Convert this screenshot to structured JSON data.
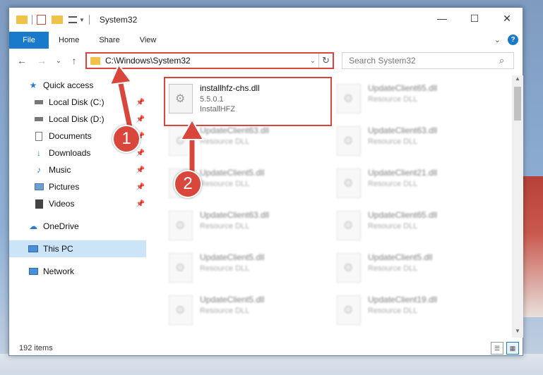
{
  "window": {
    "title": "System32",
    "controls": {
      "minimize": "—",
      "maximize": "☐",
      "close": "✕"
    }
  },
  "ribbon": {
    "tabs": [
      "File",
      "Home",
      "Share",
      "View"
    ],
    "expand_icon": "chevron-down-icon",
    "help": "?"
  },
  "nav": {
    "back": "←",
    "forward": "→",
    "recent": "⌄",
    "up": "↑",
    "address": "C:\\Windows\\System32",
    "search_placeholder": "Search System32"
  },
  "sidebar": {
    "items": [
      {
        "label": "Quick access",
        "icon": "star-icon",
        "pinned": false
      },
      {
        "label": "Local Disk (C:)",
        "icon": "drive-icon",
        "pinned": true
      },
      {
        "label": "Local Disk (D:)",
        "icon": "drive-icon",
        "pinned": true
      },
      {
        "label": "Documents",
        "icon": "document-icon",
        "pinned": true
      },
      {
        "label": "Downloads",
        "icon": "download-icon",
        "pinned": true
      },
      {
        "label": "Music",
        "icon": "music-icon",
        "pinned": true
      },
      {
        "label": "Pictures",
        "icon": "pictures-icon",
        "pinned": true
      },
      {
        "label": "Videos",
        "icon": "video-icon",
        "pinned": true
      },
      {
        "label": "OneDrive",
        "icon": "cloud-icon",
        "pinned": false
      },
      {
        "label": "This PC",
        "icon": "computer-icon",
        "pinned": false,
        "selected": true
      },
      {
        "label": "Network",
        "icon": "network-icon",
        "pinned": false
      }
    ]
  },
  "files": {
    "highlighted": {
      "name": "installhfz-chs.dll",
      "version": "5.5.0.1",
      "company": "InstallHFZ"
    },
    "others": [
      {
        "name": "UpdateClient65.dll",
        "type": "Resource DLL"
      },
      {
        "name": "UpdateClient63.dll",
        "type": "Resource DLL"
      },
      {
        "name": "UpdateClient63.dll",
        "type": "Resource DLL"
      },
      {
        "name": "UpdateClient5.dll",
        "type": "Resource DLL"
      },
      {
        "name": "UpdateClient21.dll",
        "type": "Resource DLL"
      },
      {
        "name": "UpdateClient63.dll",
        "type": "Resource DLL"
      },
      {
        "name": "UpdateClient65.dll",
        "type": "Resource DLL"
      },
      {
        "name": "UpdateClient5.dll",
        "type": "Resource DLL"
      },
      {
        "name": "UpdateClient5.dll",
        "type": "Resource DLL"
      },
      {
        "name": "UpdateClient5.dll",
        "type": "Resource DLL"
      },
      {
        "name": "UpdateClient19.dll",
        "type": "Resource DLL"
      }
    ]
  },
  "status": {
    "count": "192 items"
  },
  "callouts": {
    "one": "1",
    "two": "2",
    "color": "#d9463b"
  }
}
